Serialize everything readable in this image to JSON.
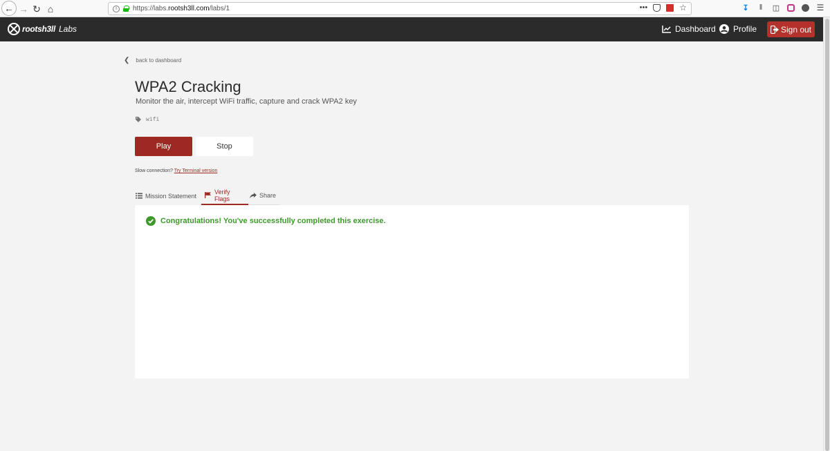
{
  "browser": {
    "url_prefix": "https://labs.",
    "url_domain": "rootsh3ll.com",
    "url_path": "/labs/1",
    "more_dots": "•••"
  },
  "header": {
    "brand_name": "rootsh3ll",
    "brand_suffix": "Labs",
    "dashboard_label": "Dashboard",
    "profile_label": "Profile",
    "signout_label": "Sign out",
    "accent_color": "#b5312b"
  },
  "page": {
    "back_label": "back to dashboard",
    "title": "WPA2 Cracking",
    "subtitle": "Monitor the air, intercept WiFi traffic, capture and crack WPA2 key",
    "tag": "wifi",
    "play_label": "Play",
    "stop_label": "Stop",
    "slow_prefix": "Slow connection?",
    "slow_link": "Try Terminal version"
  },
  "tabs": [
    {
      "label": "Mission Statement",
      "icon": "list-icon",
      "active": false
    },
    {
      "label": "Verify Flags",
      "icon": "flag-icon",
      "active": true
    },
    {
      "label": "Share",
      "icon": "share-icon",
      "active": false
    }
  ],
  "panel": {
    "success_message": "Congratulations! You've successfully completed this exercise.",
    "success_color": "#3c9a2a"
  }
}
